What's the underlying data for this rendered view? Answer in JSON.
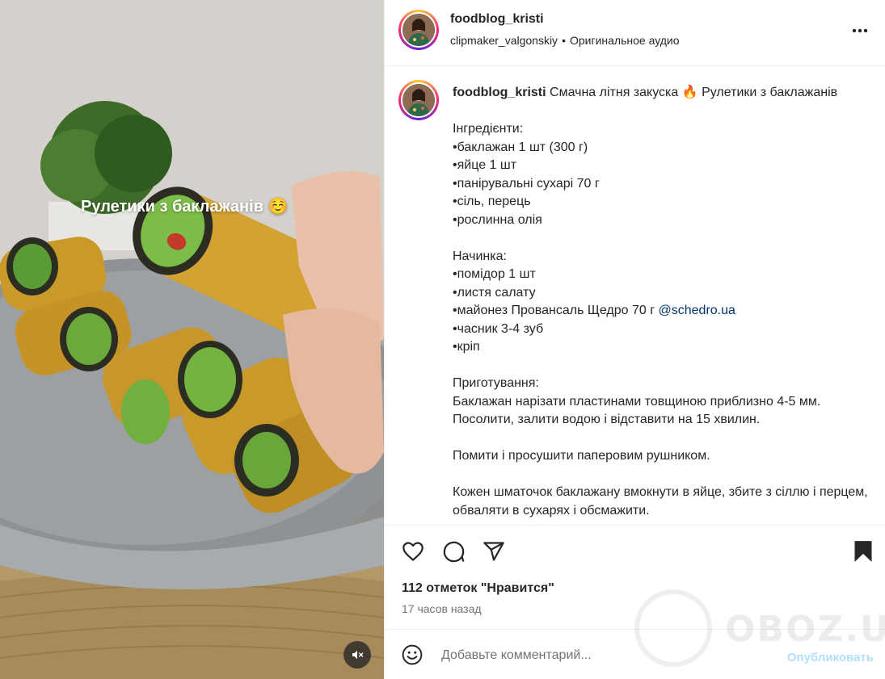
{
  "media": {
    "overlay_text": "Рулетики з баклажанів ☺️",
    "mute_icon": "speaker-muted-icon"
  },
  "header": {
    "username": "foodblog_kristi",
    "audio_author": "clipmaker_valgonskiy",
    "separator": "•",
    "audio_label": "Оригинальное аудио",
    "more_icon": "more-horizontal-icon"
  },
  "caption": {
    "username": "foodblog_kristi",
    "intro": "Смачна літня закуска 🔥 Рулетики з баклажанів",
    "body_before_link": "\n\nІнгредієнти:\n•баклажан 1 шт (300 г)\n•яйце 1 шт\n•панірувальні сухарі 70 г\n•сіль, перець\n•рослинна олія\n\nНачинка:\n•помідор 1 шт\n•листя салату\n•майонез Провансаль Щедро 70 г ",
    "link": "@schedro.ua",
    "body_after_link": "\n•часник 3-4 зуб\n•кріп\n\nПриготування:\nБаклажан нарізати пластинами товщиною приблизно 4-5 мм. Посолити, залити водою і відставити на 15 хвилин.\n\nПомити і просушити паперовим рушником.\n\nКожен шматочок баклажану вмокнути в яйце, збите з сіллю і перцем, обваляти в сухарях і обсмажити."
  },
  "actions": {
    "like_icon": "heart-icon",
    "comment_icon": "comment-bubble-icon",
    "share_icon": "paper-plane-icon",
    "save_icon": "bookmark-icon",
    "likes_text": "112 отметок \"Нравится\"",
    "time_text": "17 часов назад"
  },
  "comment_bar": {
    "emoji_icon": "smiley-icon",
    "placeholder": "Добавьте комментарий...",
    "publish_label": "Опубликовать"
  },
  "watermark": {
    "text": "OBOZ.UA"
  },
  "colors": {
    "text": "#262626",
    "secondary_text": "#737373",
    "link": "#00376b",
    "publish_disabled": "#b2dffc",
    "divider": "#efefef"
  }
}
